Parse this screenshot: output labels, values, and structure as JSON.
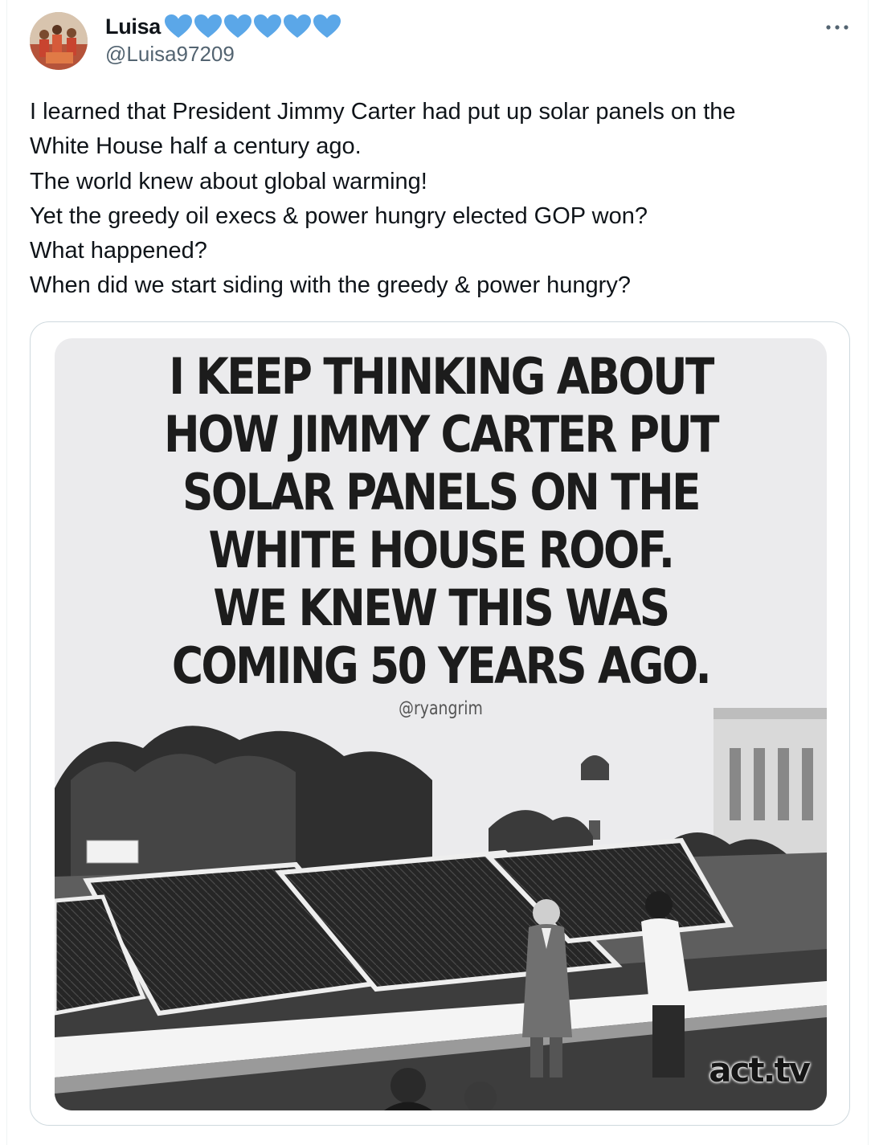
{
  "author": {
    "display_name": "Luisa",
    "handle": "@Luisa97209",
    "emoji_count": 6,
    "emoji_icon": "blue-heart-icon",
    "emoji_color": "#5ba7e8"
  },
  "tweet": {
    "lines": [
      "I learned that President Jimmy Carter had put up solar panels on the",
      "White House half a century ago.",
      "The world knew about global warming!",
      "Yet the greedy oil execs & power hungry elected GOP won?",
      "What happened?",
      "When did we start siding with the greedy & power hungry?"
    ]
  },
  "more_button": {
    "icon": "more-horizontal-icon"
  },
  "media": {
    "headline_lines": [
      "I KEEP THINKING ABOUT",
      "HOW JIMMY CARTER PUT",
      "SOLAR PANELS ON THE",
      "WHITE HOUSE ROOF.",
      "WE KNEW THIS WAS",
      "COMING 50 YEARS AGO."
    ],
    "credit": "@ryangrim",
    "watermark": "act.tv"
  },
  "colors": {
    "text_primary": "#0f1419",
    "text_secondary": "#536471",
    "border": "#cfd9de"
  }
}
